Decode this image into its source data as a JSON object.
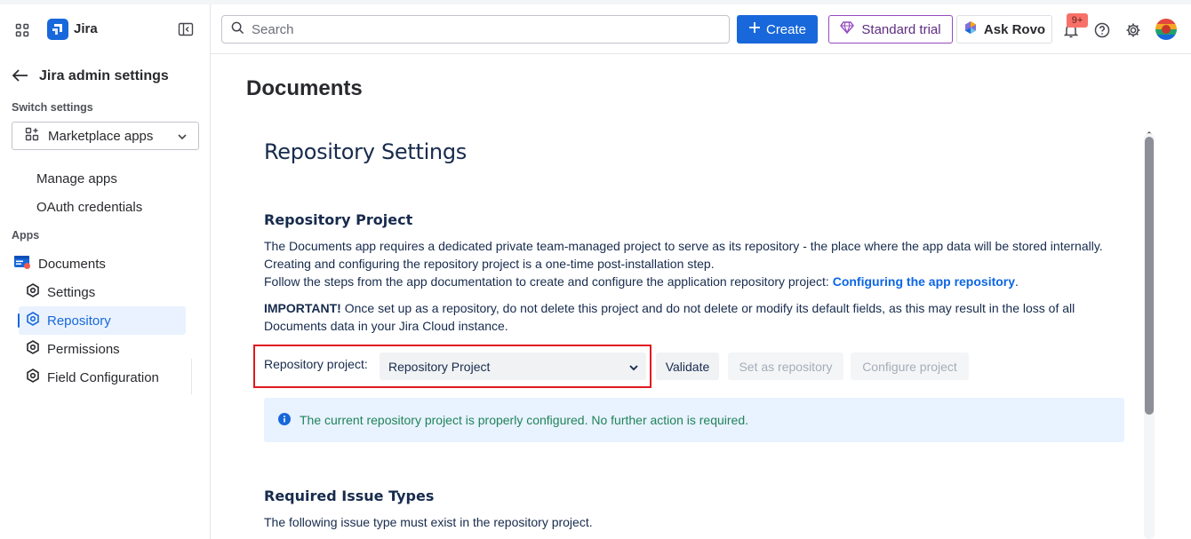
{
  "topbar": {
    "app_name": "Jira",
    "search_placeholder": "Search",
    "create_label": "Create",
    "trial_label": "Standard trial",
    "rovo_label": "Ask Rovo",
    "notification_count": "9+",
    "icons": [
      "app-switcher-icon",
      "jira-logo-icon",
      "collapse-sidebar-icon",
      "search-icon",
      "plus-icon",
      "diamond-icon",
      "rovo-icon",
      "bell-icon",
      "help-icon",
      "gear-icon",
      "avatar"
    ]
  },
  "sidebar": {
    "back_title": "Jira admin settings",
    "switch_label": "Switch settings",
    "switch_value": "Marketplace apps",
    "top_items": [
      {
        "label": "Manage apps"
      },
      {
        "label": "OAuth credentials"
      }
    ],
    "apps_label": "Apps",
    "app_name": "Documents",
    "app_items": [
      {
        "label": "Settings"
      },
      {
        "label": "Repository",
        "active": true
      },
      {
        "label": "Permissions"
      },
      {
        "label": "Field Configuration"
      }
    ]
  },
  "main": {
    "page_title": "Documents",
    "settings_title": "Repository Settings",
    "section1_title": "Repository Project",
    "para1_line1": "The Documents app requires a dedicated private team-managed project to serve as its repository - the place where the app data will be stored internally.",
    "para1_line2": "Creating and configuring the repository project is a one-time post-installation step.",
    "para1_line3": "Follow the steps from the app documentation to create and configure the application repository project: ",
    "para1_link": "Configuring the app repository",
    "para1_end": ".",
    "important_label": "IMPORTANT!",
    "important_text": " Once set up as a repository, do not delete this project and do not delete or modify its default fields, as this may result in the loss of all",
    "important_text2": "Documents data in your Jira Cloud instance.",
    "repo_label": "Repository project:",
    "repo_value": "Repository Project",
    "validate_label": "Validate",
    "set_label": "Set as repository",
    "configure_label": "Configure project",
    "info_message": "The current repository project is properly configured. No further action is required.",
    "section2_title": "Required Issue Types",
    "section2_text": "The following issue type must exist in the repository project."
  },
  "colors": {
    "brand": "#1868db",
    "active_bg": "#e9f2fe",
    "highlight": "#e0191f",
    "info_bg": "#e9f2ff",
    "success_text": "#1f845a",
    "trial_border": "#964ac0"
  }
}
